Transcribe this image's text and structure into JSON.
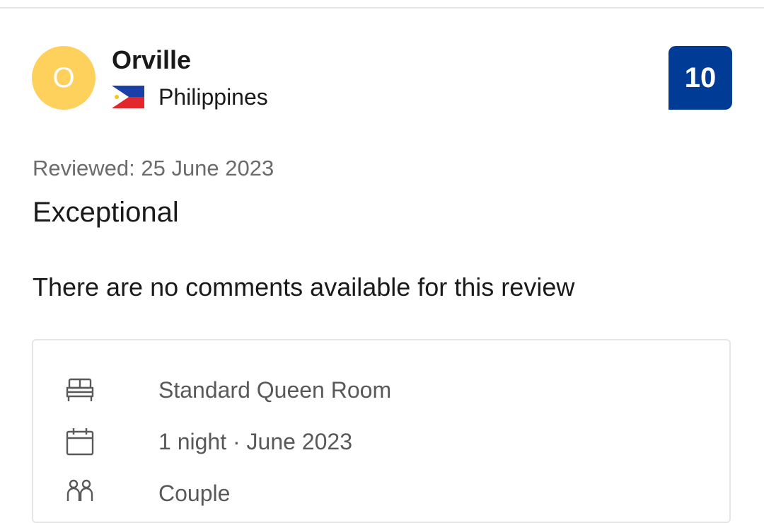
{
  "reviewer": {
    "initial": "O",
    "name": "Orville",
    "country": "Philippines",
    "avatar_color": "#fdd15c"
  },
  "score": {
    "value": "10",
    "badge_color": "#003b95"
  },
  "review": {
    "reviewed_date": "Reviewed: 25 June 2023",
    "title": "Exceptional",
    "comment": "There are no comments available for this review"
  },
  "stay_details": {
    "room": {
      "icon": "bed-icon",
      "text": "Standard Queen Room"
    },
    "stay": {
      "icon": "calendar-icon",
      "text": "1 night · June 2023"
    },
    "traveler": {
      "icon": "couple-icon",
      "text": "Couple"
    }
  }
}
